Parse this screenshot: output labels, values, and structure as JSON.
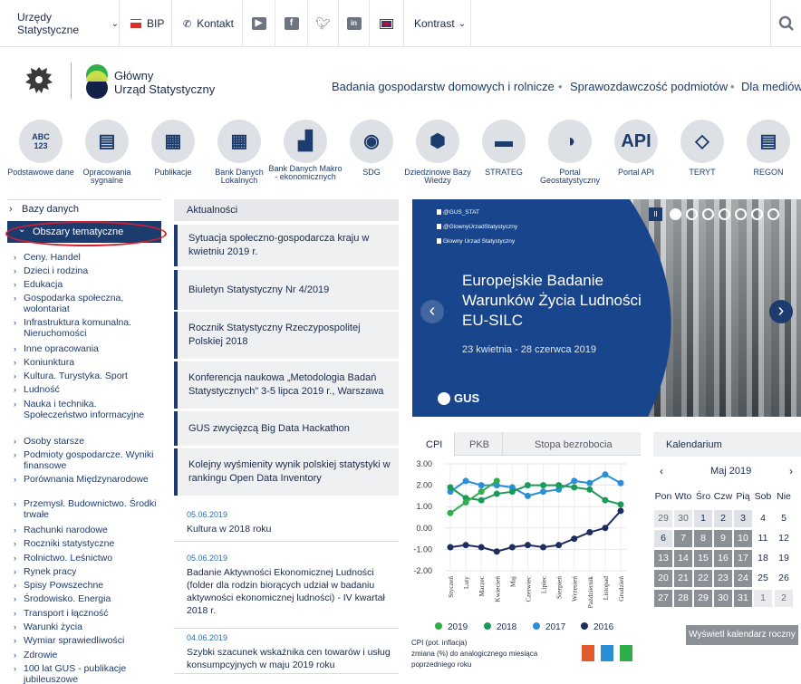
{
  "topbar": {
    "urzedy": "Urzędy Statystyczne",
    "bip": "BIP",
    "kontakt": "Kontakt",
    "kontrast": "Kontrast"
  },
  "header": {
    "org_line1": "Główny",
    "org_line2": "Urząd Statystyczny",
    "nav": [
      "Badania gospodarstw domowych i rolnicze",
      "Sprawozdawczość podmiotów",
      "Dla mediów"
    ]
  },
  "icons": [
    {
      "label": "Podstawowe dane",
      "icon": "abc-123-icon"
    },
    {
      "label": "Opracowania sygnalne",
      "icon": "chat-icon"
    },
    {
      "label": "Publikacje",
      "icon": "newspaper-icon"
    },
    {
      "label": "Bank Danych Lokalnych",
      "icon": "grid-icon"
    },
    {
      "label": "Bank Danych Makro - ekonomicznych",
      "icon": "blocks-icon"
    },
    {
      "label": "SDG",
      "icon": "sdg-wheel-icon"
    },
    {
      "label": "Dziedzinowe Bazy Wiedzy",
      "icon": "hexagon-icon"
    },
    {
      "label": "STRATEG",
      "icon": "strateg-icon"
    },
    {
      "label": "Portal Geostatystyczny",
      "icon": "globe-icon"
    },
    {
      "label": "Portal API",
      "icon": "api-icon"
    },
    {
      "label": "TERYT",
      "icon": "poland-map-icon"
    },
    {
      "label": "REGON",
      "icon": "document-search-icon"
    }
  ],
  "sidebar": {
    "bazy": "Bazy danych",
    "obszary": "Obszary tematyczne",
    "items": [
      "Ceny. Handel",
      "Dzieci i rodzina",
      "Edukacja",
      "Gospodarka społeczna, wolontariat",
      "Infrastruktura komunalna. Nieruchomości",
      "Inne opracowania",
      "Koniunktura",
      "Kultura. Turystyka. Sport",
      "Ludność",
      "Nauka i technika. Społeczeństwo informacyjne",
      "Osoby starsze",
      "Podmioty gospodarcze. Wyniki finansowe",
      "Porównania Międzynarodowe",
      "Przemysł. Budownictwo. Środki trwałe",
      "Rachunki narodowe",
      "Roczniki statystyczne",
      "Rolnictwo. Leśnictwo",
      "Rynek pracy",
      "Spisy Powszechne",
      "Środowisko. Energia",
      "Transport i łączność",
      "Warunki życia",
      "Wymiar sprawiedliwości",
      "Zdrowie",
      "100 lat GUS - publikacje jubileuszowe"
    ]
  },
  "news": {
    "header": "Aktualności",
    "boxes": [
      "Sytuacja społeczno-gospodarcza kraju w kwietniu 2019 r.",
      "Biuletyn Statystyczny Nr 4/2019",
      "Rocznik Statystyczny Rzeczypospolitej Polskiej 2018",
      "Konferencja naukowa „Metodologia Badań Statystycznych” 3-5 lipca 2019 r., Warszawa",
      "GUS zwycięzcą Big Data Hackathon",
      "Kolejny wyśmienity wynik polskiej statystyki w rankingu Open Data Inventory"
    ],
    "dated": [
      {
        "date": "05.06.2019",
        "text": "Kultura w 2018 roku"
      },
      {
        "date": "05.06.2019",
        "text": "Badanie Aktywności Ekonomicznej Ludności (folder dla rodzin biorących udział w badaniu aktywności ekonomicznej ludności) - IV kwartał 2018 r."
      },
      {
        "date": "04.06.2019",
        "text": "Szybki szacunek wskaźnika cen towarów i usług konsumpcyjnych w maju 2019 roku"
      }
    ]
  },
  "banner": {
    "social": [
      "@GUS_STAT",
      "@GlownyUrzadStatystyczny",
      "Glowny Urzad Statystyczny"
    ],
    "title_l1": "Europejskie Badanie",
    "title_l2": "Warunków Życia Ludności",
    "title_l3": "EU-SILC",
    "dates": "23 kwietnia - 28 czerwca 2019",
    "logo": "GUS",
    "pause": "II"
  },
  "chart_tabs": [
    "CPI",
    "PKB",
    "Stopa bezrobocia"
  ],
  "chart_data": {
    "type": "line",
    "categories": [
      "Styczeń",
      "Luty",
      "Marzec",
      "Kwiecień",
      "Maj",
      "Czerwiec",
      "Lipiec",
      "Sierpień",
      "Wrzesień",
      "Październik",
      "Listopad",
      "Grudzień"
    ],
    "ylim": [
      -2.0,
      3.0
    ],
    "yticks": [
      "3.00",
      "2.00",
      "1.00",
      "0.00",
      "-1.00",
      "-2.00"
    ],
    "series": [
      {
        "name": "2019",
        "color": "#2fae4a",
        "values": [
          0.7,
          1.2,
          1.7,
          2.2
        ]
      },
      {
        "name": "2018",
        "color": "#1a9a5a",
        "values": [
          1.9,
          1.4,
          1.3,
          1.6,
          1.7,
          2.0,
          2.0,
          2.0,
          1.9,
          1.8,
          1.3,
          1.1
        ]
      },
      {
        "name": "2017",
        "color": "#2a8fd6",
        "values": [
          1.7,
          2.2,
          2.0,
          2.0,
          1.9,
          1.5,
          1.7,
          1.8,
          2.2,
          2.1,
          2.5,
          2.1
        ]
      },
      {
        "name": "2016",
        "color": "#1d2d5e",
        "values": [
          -0.9,
          -0.8,
          -0.9,
          -1.1,
          -0.9,
          -0.8,
          -0.9,
          -0.8,
          -0.5,
          -0.2,
          0.0,
          0.8
        ]
      }
    ],
    "note": "CPI (pot. inflacja) zmiana (%) do analogicznego miesiąca poprzedniego roku"
  },
  "calendar": {
    "header": "Kalendarium",
    "month": "Maj 2019",
    "days": [
      "Pon",
      "Wto",
      "Śro",
      "Czw",
      "Pią",
      "Sob",
      "Nie"
    ],
    "rows": [
      [
        "29",
        "30",
        "1",
        "2",
        "3",
        "4",
        "5"
      ],
      [
        "6",
        "7",
        "8",
        "9",
        "10",
        "11",
        "12"
      ],
      [
        "13",
        "14",
        "15",
        "16",
        "17",
        "18",
        "19"
      ],
      [
        "20",
        "21",
        "22",
        "23",
        "24",
        "25",
        "26"
      ],
      [
        "27",
        "28",
        "29",
        "30",
        "31",
        "1",
        "2"
      ]
    ],
    "button": "Wyświetl kalendarz roczny"
  }
}
